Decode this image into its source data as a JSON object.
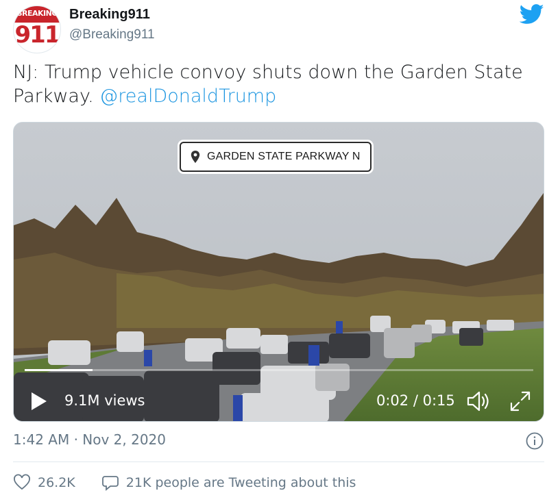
{
  "author": {
    "avatar_top_text": "BREAKING",
    "avatar_number": "911",
    "display_name": "Breaking911",
    "handle": "@Breaking911"
  },
  "tweet": {
    "text": "NJ: Trump vehicle convoy shuts down the Garden State Parkway.",
    "mention": "@realDonaldTrump"
  },
  "video": {
    "location_tag": "GARDEN STATE PARKWAY N",
    "views": "9.1M views",
    "time": "0:02 / 0:15",
    "progress": 0.133
  },
  "timestamp": "1:42 AM · Nov 2, 2020",
  "actions": {
    "likes": "26.2K",
    "discussion": "21K people are Tweeting about this"
  },
  "colors": {
    "link": "#1b95e0",
    "secondary_text": "#657786",
    "twitter_blue": "#1da1f2",
    "brand_red": "#c9252c"
  },
  "icons": [
    "twitter-logo-icon",
    "location-pin-icon",
    "play-icon",
    "volume-icon",
    "expand-icon",
    "info-icon",
    "heart-icon",
    "comment-icon"
  ]
}
